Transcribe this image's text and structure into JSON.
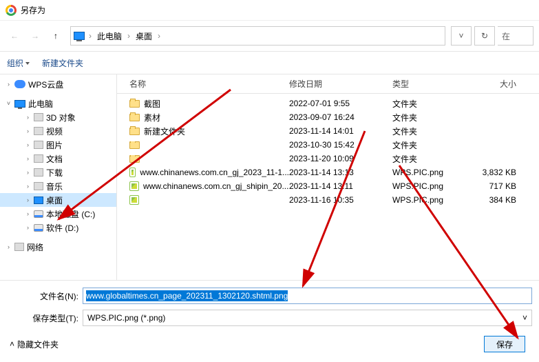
{
  "title": "另存为",
  "breadcrumb": {
    "root": "此电脑",
    "current": "桌面"
  },
  "addrbar": {
    "dropdown_hint": "v",
    "refresh_hint": "↻",
    "search_placeholder": "在"
  },
  "toolbar": {
    "organize": "组织",
    "new_folder": "新建文件夹"
  },
  "sidebar": {
    "wps": "WPS云盘",
    "pc": "此电脑",
    "items": [
      "3D 对象",
      "视频",
      "图片",
      "文档",
      "下载",
      "音乐",
      "桌面",
      "本地磁盘 (C:)",
      "软件 (D:)"
    ],
    "network": "网络"
  },
  "columns": {
    "name": "名称",
    "date": "修改日期",
    "type": "类型",
    "size": "大小"
  },
  "types": {
    "folder": "文件夹",
    "png": "WPS.PIC.png"
  },
  "files": [
    {
      "name": "截图",
      "date": "2022-07-01 9:55",
      "type_key": "folder",
      "size": "",
      "icon": "folder"
    },
    {
      "name": "素材",
      "date": "2023-09-07 16:24",
      "type_key": "folder",
      "size": "",
      "icon": "folder"
    },
    {
      "name": "新建文件夹",
      "date": "2023-11-14 14:01",
      "type_key": "folder",
      "size": "",
      "icon": "folder"
    },
    {
      "name": "",
      "date": "2023-10-30 15:42",
      "type_key": "folder",
      "size": "",
      "icon": "folder",
      "blur": true
    },
    {
      "name": "",
      "date": "2023-11-20 10:09",
      "type_key": "folder",
      "size": "",
      "icon": "folder",
      "blur": true
    },
    {
      "name": "www.chinanews.com.cn_gj_2023_11-1...",
      "date": "2023-11-14 13:13",
      "type_key": "png",
      "size": "3,832 KB",
      "icon": "img"
    },
    {
      "name": "www.chinanews.com.cn_gj_shipin_20...",
      "date": "2023-11-14 13:11",
      "type_key": "png",
      "size": "717 KB",
      "icon": "img"
    },
    {
      "name": "",
      "date": "2023-11-16 10:35",
      "type_key": "png",
      "size": "384 KB",
      "icon": "img",
      "blur": true
    }
  ],
  "form": {
    "filename_label": "文件名(N):",
    "filename_value": "www.globaltimes.cn_page_202311_1302120.shtml.png",
    "filetype_label": "保存类型(T):",
    "filetype_value": "WPS.PIC.png (*.png)"
  },
  "footer": {
    "hide_files": "隐藏文件夹",
    "save": "保存"
  }
}
